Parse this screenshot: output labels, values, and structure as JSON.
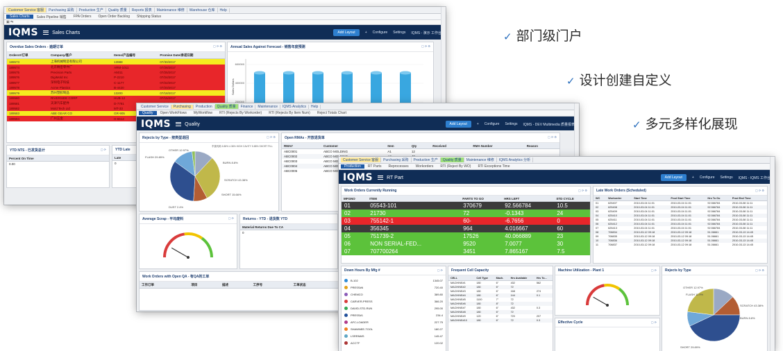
{
  "features": [
    "部门级门户",
    "设计创建自定义",
    "多元多样化展现"
  ],
  "colors": {
    "header": "#102d56",
    "accent": "#2e7fcf",
    "row_red": "#e8262a",
    "row_yellow": "#f5ec1f",
    "row_green": "#5cc23b",
    "row_dark": "#3b3b3b",
    "bar_blue": "#39a7e0",
    "bar_yellow": "#f2c400"
  },
  "win1": {
    "tabs": [
      "Customer Service 客服",
      "Purchasing 采购",
      "Production 生产",
      "Quality 质量",
      "Reports 报表",
      "Maintenance 维修",
      "Warehouse 仓库",
      "Help"
    ],
    "subtabs": [
      "Sales Charts",
      "Sales Pipeline 销售",
      "FPA Orders",
      "Open Order Backlog",
      "Shipping Status"
    ],
    "logo": "IQMS",
    "title": "Sales Charts",
    "btn": "Add Layout",
    "links": [
      "Configure",
      "Settings",
      "IQMS - 演示 工作台"
    ],
    "orders": {
      "title": "Overdue Sales Orders - 逾期订单",
      "columns": [
        "Orders#/订单",
        "Company/客户",
        "Items/产品编号",
        "Promise Date/承诺日期"
      ],
      "rows": [
        {
          "cells": [
            "189573",
            "上海机械制造有限公司",
            "13988",
            "07/30/2017"
          ],
          "tone": "yellow"
        },
        {
          "cells": [
            "189574",
            "北京精密零件厂",
            "ARM-1011",
            "07/28/2017"
          ],
          "tone": "red"
        },
        {
          "cells": [
            "189575",
            "Precision Parts",
            "A5011",
            "07/25/2017"
          ],
          "tone": "red"
        },
        {
          "cells": [
            "189576",
            "DigiMold Inc",
            "P-2210",
            "07/24/2017"
          ],
          "tone": "red"
        },
        {
          "cells": [
            "189577",
            "深圳电子科技",
            "C-1177",
            "07/22/2017"
          ],
          "tone": "red"
        },
        {
          "cells": [
            "189578",
            "Acme Plastics",
            "B-4420",
            "07/20/2017"
          ],
          "tone": "red"
        },
        {
          "cells": [
            "189579",
            "苏州塑胶制品",
            "13200",
            "07/18/2017"
          ],
          "tone": "yellow"
        },
        {
          "cells": [
            "189580",
            "RIVERSIDE CORP",
            "HUB-12",
            "07/15/2017"
          ],
          "tone": "red"
        },
        {
          "cells": [
            "189581",
            "天津汽车配件",
            "D-7781",
            "07/12/2017"
          ],
          "tone": "red"
        },
        {
          "cells": [
            "189582",
            "Mold Tech Ltd",
            "MT-33",
            "07/10/2017"
          ],
          "tone": "red"
        },
        {
          "cells": [
            "189583",
            "ABE GEAR CO",
            "GR-905",
            "07/08/2017"
          ],
          "tone": "yellow"
        },
        {
          "cells": [
            "189584",
            "广州五金",
            "H-6612",
            "07/05/2017"
          ],
          "tone": "red"
        }
      ]
    },
    "chart": {
      "title": "Annual Sales Against Forecast - 销售年度预测",
      "ylabel": "Sales Dollars",
      "xlabel": "Fiscal Period",
      "yticks": [
        "600000",
        "400000",
        "200000",
        "0"
      ]
    },
    "shipped": {
      "title": "YTD NTS - 已发货总计",
      "col": "Percent On Time",
      "value": "0.00"
    },
    "late": {
      "title": "YTD Late",
      "col": "Late",
      "value": "0"
    }
  },
  "win2": {
    "tabs": [
      "Customer Service",
      "Purchasing",
      "Production",
      "Quality 质量",
      "Finance",
      "Maintenance",
      "IQMS Analytics",
      "Help"
    ],
    "subtabs": [
      "Quality",
      "Open WorkFlows",
      "MyWorkflow",
      "RTI (Rejects By Workorder)",
      "RTI (Rejects By Item Num)",
      "Reject Totals Chart"
    ],
    "title": "Quality",
    "btn": "Add Layout",
    "links": [
      "Configure",
      "Settings",
      "IQMS - DEV Multimedia 质量报表"
    ],
    "pie": {
      "title": "Rejects by Type - 按类型退回",
      "labels": [
        "OTHER 12.97%",
        "FLASH 29.89%",
        "BURN 8.8%",
        "SCRATCH 43.38%",
        "SHORT 15.66%",
        "DUST 2.4%"
      ],
      "legend": "不良代码 5.88% 4.36% HIGH CAVITY 5.88% SHORT FILL"
    },
    "openrma": {
      "title": "Open RMAs - 开放退货单",
      "columns": [
        "RMA#",
        "Customer",
        "Item",
        "Qty",
        "Received",
        "RMA Number",
        "Reason"
      ],
      "rows": [
        [
          "ABC0001",
          "ABCO MOLDING",
          "A1",
          "12",
          "",
          "",
          ""
        ],
        [
          "ABC0002",
          "ABCO MOLDING",
          "A2",
          "40",
          "",
          "",
          ""
        ],
        [
          "ABC0003",
          "ABCO MOLDING",
          "B9",
          "8",
          "",
          "",
          ""
        ],
        [
          "ABC0004",
          "ABCO MOLDING",
          "C5",
          "20",
          "",
          "",
          ""
        ],
        [
          "ABC0005",
          "ABCO MOLDING",
          "D1",
          "3",
          "",
          "",
          ""
        ]
      ]
    },
    "gauge1": {
      "title": "Average Scrap - 平均废料"
    },
    "returns": {
      "title": "Returns - YTD - 退货数 YTD",
      "col": "Material Returns Due To CA",
      "value": "0"
    },
    "wo": {
      "title": "Work Orders with Open QA - 有QA的工单",
      "columns": [
        "工作订单",
        "项目",
        "描述",
        "工序号",
        "工单状态"
      ]
    }
  },
  "win3": {
    "tabs": [
      "Customer Service 客服",
      "Purchasing 采购",
      "Production 生产",
      "Quality 质量",
      "Maintenance 维修",
      "IQMS Analytics 分析"
    ],
    "subtabs": [
      "Production",
      "RT Parts",
      "Reprocesses",
      "Workorders",
      "RTI (Reject By WO)",
      "RTI Exceptions Time"
    ],
    "title": "RT Part",
    "btn": "Add Layout",
    "links": [
      "Configure",
      "Settings",
      "IQMS - IQMS 工作台"
    ],
    "workorders": {
      "title": "Work Orders Currently Running",
      "columns": [
        "MFGNO",
        "ITEM",
        "PARTS TO GO",
        "HRS LEFT",
        "STD CYCLE"
      ],
      "rows": [
        {
          "cells": [
            "01",
            "05543-101",
            "370679",
            "92.566784",
            "10.5"
          ],
          "tone": "dark"
        },
        {
          "cells": [
            "02",
            "21730",
            "72",
            "-0.1343",
            "24"
          ],
          "tone": "green"
        },
        {
          "cells": [
            "03",
            "755142-1",
            "60-",
            "-6.7656",
            "0"
          ],
          "tone": "red"
        },
        {
          "cells": [
            "04",
            "356345",
            "964",
            "4.016667",
            "60"
          ],
          "tone": "dark"
        },
        {
          "cells": [
            "05",
            "751739-2",
            "17526",
            "40.066889",
            "23"
          ],
          "tone": "green"
        },
        {
          "cells": [
            "06",
            "NON SERIAL-FED...",
            "9520",
            "7.0077",
            "30"
          ],
          "tone": "green"
        },
        {
          "cells": [
            "07",
            "707700264",
            "3451",
            "7.865167",
            "7.5"
          ],
          "tone": "green"
        }
      ]
    },
    "late": {
      "title": "Late Work Orders (Scheduled)",
      "columns": [
        "WC",
        "Workorder",
        "Start Time",
        "Prod Start Time",
        "Hrs To Go",
        "Prod End Time"
      ],
      "rows": [
        [
          "01",
          "625407",
          "2010-03-04 11:01",
          "2010-03-04 11:01",
          "92.566784",
          "2010-03-08 11:11"
        ],
        [
          "02",
          "625408",
          "2010-03-04 11:01",
          "2010-03-04 11:01",
          "92.566784",
          "2010-03-08 11:11"
        ],
        [
          "03",
          "625409",
          "2010-03-04 11:01",
          "2010-03-04 11:01",
          "92.566784",
          "2010-03-08 11:11"
        ],
        [
          "04",
          "625410",
          "2010-03-04 11:01",
          "2010-03-04 11:01",
          "92.566784",
          "2010-03-08 11:11"
        ],
        [
          "05",
          "625411",
          "2010-03-04 11:01",
          "2010-03-04 11:01",
          "92.566784",
          "2010-03-08 11:11"
        ],
        [
          "06",
          "625412",
          "2010-03-04 11:01",
          "2010-03-04 11:01",
          "92.566784",
          "2010-03-08 11:11"
        ],
        [
          "07",
          "625413",
          "2010-03-04 11:01",
          "2010-03-04 11:01",
          "92.566784",
          "2010-03-08 11:11"
        ],
        [
          "08",
          "708834",
          "2010-03-12 09:18",
          "2010-03-12 09:18",
          "51.06661",
          "2010-03-13 14:45"
        ],
        [
          "09",
          "708835",
          "2010-03-12 09:18",
          "2010-03-12 09:18",
          "51.06661",
          "2010-03-13 14:45"
        ],
        [
          "10",
          "708836",
          "2010-03-12 09:18",
          "2010-03-12 09:18",
          "51.06661",
          "2010-03-13 14:45"
        ],
        [
          "11",
          "708837",
          "2010-03-12 09:18",
          "2010-03-12 09:18",
          "51.06661",
          "2010-03-13 14:45"
        ]
      ]
    },
    "downhours": {
      "title": "Down Hours By Mfg #",
      "items": [
        {
          "label": "B-102",
          "value": "1345.07",
          "color": "#2e8bd6"
        },
        {
          "label": "PRESS#6",
          "value": "720.40",
          "color": "#e3a21a"
        },
        {
          "label": "CHEMCO",
          "value": "389.80",
          "color": "#8a5bb8"
        },
        {
          "label": "CARVER-PRESS",
          "value": "366.20",
          "color": "#d93b3b"
        },
        {
          "label": "DAVID-STD-RUN",
          "value": "295.00",
          "color": "#33a852"
        },
        {
          "label": "PRESS#1",
          "value": "234.4",
          "color": "#1f4f9a"
        },
        {
          "label": "AFC-LOADER",
          "value": "227.75",
          "color": "#b03a8a"
        },
        {
          "label": "SHAWNEE-TOOL",
          "value": "180.27",
          "color": "#f07f1f"
        },
        {
          "label": "LSRRNMS",
          "value": "145.47",
          "color": "#5ea6c4"
        },
        {
          "label": "ACCTF",
          "value": "120.02",
          "color": "#a33"
        }
      ]
    },
    "capacity": {
      "title": "Frequent Cell Capacity",
      "columns": [
        "CELL",
        "Cell Type",
        "Mach.",
        "Hrs Available",
        "Hrs To..."
      ],
      "rows": [
        [
          "MACHINE#1",
          "180",
          "6\"",
          "432",
          "562"
        ],
        [
          "MACHINE#2",
          "180",
          "6\"",
          "72",
          ""
        ],
        [
          "MACHINE#3",
          "180",
          "6\"",
          "168",
          "274"
        ],
        [
          "MACHINE#4",
          "180",
          "6\"",
          "144",
          "0.1"
        ],
        [
          "MACHINE#5",
          "1100",
          "7\"",
          "72",
          ""
        ],
        [
          "MACHINE#6",
          "180",
          "8\"",
          "72",
          ""
        ],
        [
          "MACHINE#7",
          "180",
          "6\"",
          "432",
          "0.3"
        ],
        [
          "MACHINE#8",
          "180",
          "6\"",
          "72",
          ""
        ],
        [
          "MACHINE#9",
          "120",
          "6\"",
          "720",
          "207"
        ],
        [
          "MACHINE#10",
          "180",
          "6\"",
          "72",
          "0.3"
        ]
      ]
    },
    "machutil": {
      "title": "Machine Utilization - Plant 1"
    },
    "effective": {
      "title": "Effective Cycle"
    },
    "pie": {
      "title": "Rejects by Type",
      "labels": [
        "OTHER 12.97%",
        "FLASH 11.9%",
        "SCRATCH 43.38%",
        "BURN 8.8%",
        "SHORT 29.89%"
      ]
    }
  }
}
